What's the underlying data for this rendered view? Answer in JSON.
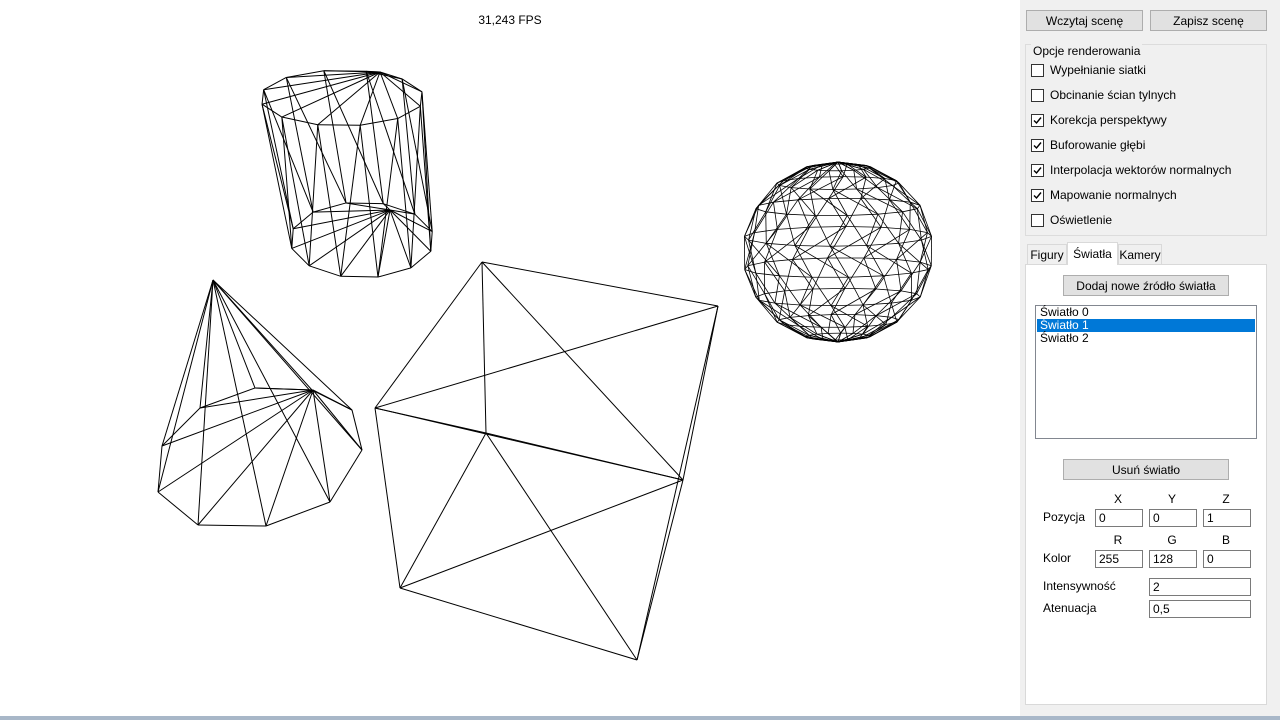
{
  "viewport": {
    "fps_text": "31,243 FPS",
    "shapes": [
      "cylinder",
      "cone",
      "cube",
      "sphere"
    ]
  },
  "toolbar": {
    "load_label": "Wczytaj scenę",
    "save_label": "Zapisz scenę"
  },
  "render_options": {
    "title": "Opcje renderowania",
    "items": [
      {
        "label": "Wypełnianie siatki",
        "checked": false
      },
      {
        "label": "Obcinanie ścian tylnych",
        "checked": false
      },
      {
        "label": "Korekcja perspektywy",
        "checked": true
      },
      {
        "label": "Buforowanie głębi",
        "checked": true
      },
      {
        "label": "Interpolacja wektorów normalnych",
        "checked": true
      },
      {
        "label": "Mapowanie normalnych",
        "checked": true
      },
      {
        "label": "Oświetlenie",
        "checked": false
      }
    ]
  },
  "tabs": [
    {
      "label": "Figury",
      "active": false
    },
    {
      "label": "Światła",
      "active": true
    },
    {
      "label": "Kamery",
      "active": false
    }
  ],
  "lights": {
    "add_label": "Dodaj nowe źródło światła",
    "remove_label": "Usuń światło",
    "items": [
      {
        "label": "Światło 0",
        "selected": false
      },
      {
        "label": "Światło 1",
        "selected": true
      },
      {
        "label": "Światło 2",
        "selected": false
      }
    ],
    "position": {
      "label": "Pozycja",
      "axes": [
        "X",
        "Y",
        "Z"
      ],
      "values": [
        "0",
        "0",
        "1"
      ]
    },
    "color": {
      "label": "Kolor",
      "channels": [
        "R",
        "G",
        "B"
      ],
      "values": [
        "255",
        "128",
        "0"
      ]
    },
    "intensity": {
      "label": "Intensywność",
      "value": "2"
    },
    "attenuation": {
      "label": "Atenuacja",
      "value": "0,5"
    }
  },
  "colors": {
    "selection": "#0078d7",
    "panel_bg": "#f0f0f0",
    "wire": "#000000"
  }
}
